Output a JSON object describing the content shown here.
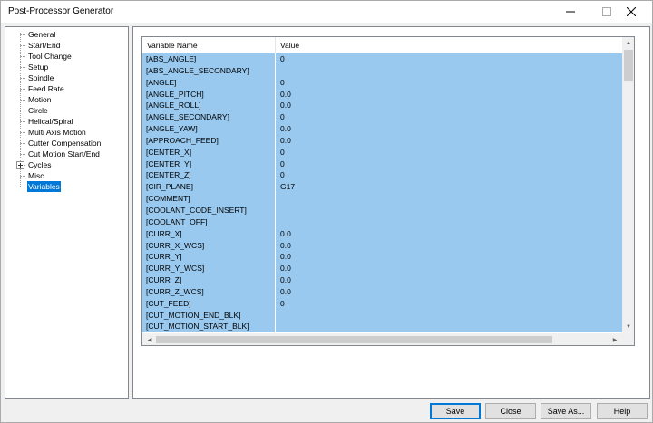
{
  "window": {
    "title": "Post-Processor Generator"
  },
  "tree": {
    "items": [
      {
        "label": "General"
      },
      {
        "label": "Start/End"
      },
      {
        "label": "Tool Change"
      },
      {
        "label": "Setup"
      },
      {
        "label": "Spindle"
      },
      {
        "label": "Feed Rate"
      },
      {
        "label": "Motion"
      },
      {
        "label": "Circle"
      },
      {
        "label": "Helical/Spiral"
      },
      {
        "label": "Multi Axis Motion"
      },
      {
        "label": "Cutter Compensation"
      },
      {
        "label": "Cut Motion Start/End"
      },
      {
        "label": "Cycles",
        "expandable": true
      },
      {
        "label": "Misc"
      },
      {
        "label": "Variables",
        "selected": true
      }
    ]
  },
  "grid": {
    "columns": [
      "Variable Name",
      "Value"
    ],
    "rows": [
      [
        "[ABS_ANGLE]",
        "0"
      ],
      [
        "[ABS_ANGLE_SECONDARY]",
        ""
      ],
      [
        "[ANGLE]",
        "0"
      ],
      [
        "[ANGLE_PITCH]",
        "0.0"
      ],
      [
        "[ANGLE_ROLL]",
        "0.0"
      ],
      [
        "[ANGLE_SECONDARY]",
        "0"
      ],
      [
        "[ANGLE_YAW]",
        "0.0"
      ],
      [
        "[APPROACH_FEED]",
        "0.0"
      ],
      [
        "[CENTER_X]",
        "0"
      ],
      [
        "[CENTER_Y]",
        "0"
      ],
      [
        "[CENTER_Z]",
        "0"
      ],
      [
        "[CIR_PLANE]",
        "G17"
      ],
      [
        "[COMMENT]",
        ""
      ],
      [
        "[COOLANT_CODE_INSERT]",
        ""
      ],
      [
        "[COOLANT_OFF]",
        ""
      ],
      [
        "[CURR_X]",
        "0.0"
      ],
      [
        "[CURR_X_WCS]",
        "0.0"
      ],
      [
        "[CURR_Y]",
        "0.0"
      ],
      [
        "[CURR_Y_WCS]",
        "0.0"
      ],
      [
        "[CURR_Z]",
        "0.0"
      ],
      [
        "[CURR_Z_WCS]",
        "0.0"
      ],
      [
        "[CUT_FEED]",
        "0"
      ],
      [
        "[CUT_MOTION_END_BLK]",
        ""
      ],
      [
        "[CUT_MOTION_START_BLK]",
        ""
      ]
    ]
  },
  "buttons": {
    "save": "Save",
    "close": "Close",
    "save_as": "Save As...",
    "help": "Help"
  }
}
